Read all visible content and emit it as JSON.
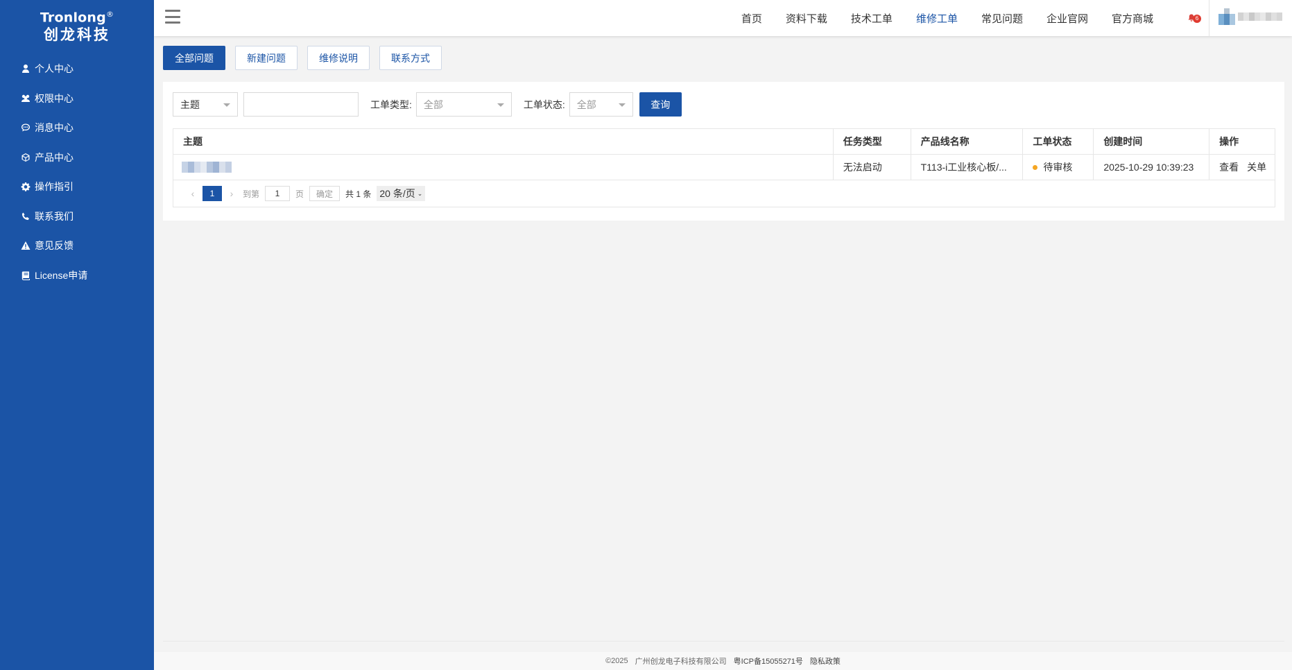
{
  "brand": {
    "name_en": "Tronlong",
    "reg_mark": "®",
    "name_cn": "创龙科技"
  },
  "sidebar": {
    "items": [
      {
        "label": "个人中心",
        "icon": "user-icon"
      },
      {
        "label": "权限中心",
        "icon": "users-icon"
      },
      {
        "label": "消息中心",
        "icon": "chat-icon"
      },
      {
        "label": "产品中心",
        "icon": "cube-icon"
      },
      {
        "label": "操作指引",
        "icon": "gear-icon"
      },
      {
        "label": "联系我们",
        "icon": "phone-icon"
      },
      {
        "label": "意见反馈",
        "icon": "warning-icon"
      },
      {
        "label": "License申请",
        "icon": "book-icon"
      }
    ]
  },
  "header": {
    "nav": [
      "首页",
      "资料下载",
      "技术工单",
      "维修工单",
      "常见问题",
      "企业官网",
      "官方商城"
    ],
    "active_nav": "维修工单",
    "notification_count": "6"
  },
  "tabs": [
    "全部问题",
    "新建问题",
    "维修说明",
    "联系方式"
  ],
  "active_tab": "全部问题",
  "filters": {
    "subject_select": "主题",
    "keyword_value": "",
    "type_label": "工单类型:",
    "type_value": "全部",
    "status_label": "工单状态:",
    "status_value": "全部",
    "query_button": "查询"
  },
  "table": {
    "columns": [
      "主题",
      "任务类型",
      "产品线名称",
      "工单状态",
      "创建时间",
      "操作"
    ],
    "rows": [
      {
        "subject": "",
        "task_type": "无法启动",
        "product_line": "T113-i工业核心板/...",
        "status": "待审核",
        "created": "2025-10-29 10:39:23",
        "actions": [
          "查看",
          "关单"
        ]
      }
    ]
  },
  "pagination": {
    "current_page": "1",
    "goto_prefix": "到第",
    "goto_value": "1",
    "goto_suffix": "页",
    "confirm": "确定",
    "total": "共 1 条",
    "page_size": "20 条/页"
  },
  "footer": {
    "copyright": "©2025",
    "company": "广州创龙电子科技有限公司",
    "icp": "粤ICP备15055271号",
    "privacy": "隐私政策"
  },
  "colors": {
    "primary": "#1b54a6",
    "status_pending": "#f5a623",
    "badge": "#e03b30"
  }
}
